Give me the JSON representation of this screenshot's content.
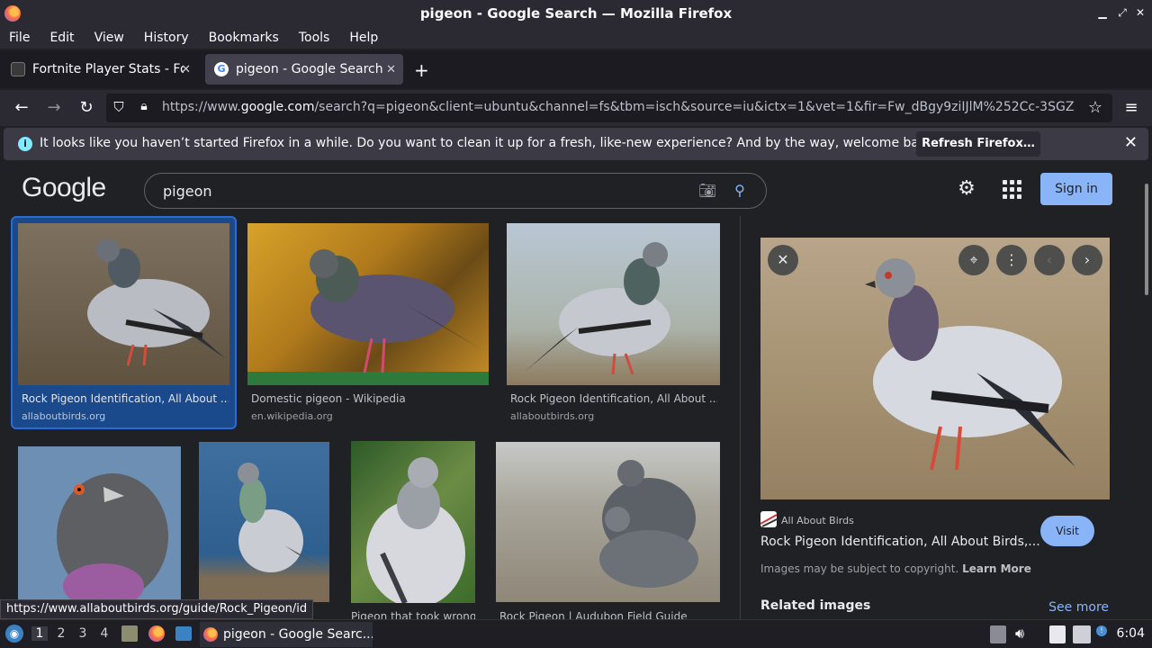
{
  "window": {
    "title": "pigeon - Google Search — Mozilla Firefox"
  },
  "menu": [
    "File",
    "Edit",
    "View",
    "History",
    "Bookmarks",
    "Tools",
    "Help"
  ],
  "tabs": [
    {
      "label": "Fortnite Player Stats - Fo",
      "active": false
    },
    {
      "label": "pigeon - Google Search",
      "active": true
    }
  ],
  "nav": {
    "url_prefix": "https://www.",
    "url_domain": "google.com",
    "url_rest": "/search?q=pigeon&client=ubuntu&channel=fs&tbm=isch&source=iu&ictx=1&vet=1&fir=Fw_dBgy9ziIJlM%252Cc-3SGZ"
  },
  "notification": {
    "message": "It looks like you haven’t started Firefox in a while. Do you want to clean it up for a fresh, like-new experience? And by the way, welcome back!",
    "button": "Refresh Firefox…"
  },
  "google": {
    "logo": "Google",
    "query": "pigeon",
    "signin": "Sign in"
  },
  "results": [
    {
      "title": "Rock Pigeon Identification, All About ...",
      "source": "allaboutbirds.org"
    },
    {
      "title": "Domestic pigeon - Wikipedia",
      "source": "en.wikipedia.org"
    },
    {
      "title": "Rock Pigeon Identification, All About ...",
      "source": "allaboutbirds.org"
    },
    {
      "title": "Pigeon that took wrong ...",
      "source": ""
    },
    {
      "title": "Rock Pigeon | Audubon Field Guide",
      "source": ""
    }
  ],
  "panel": {
    "site": "All About Birds",
    "title": "Rock Pigeon Identification, All About Birds,...",
    "visit": "Visit",
    "copyright": "Images may be subject to copyright.",
    "learn_more": "Learn More",
    "related": "Related images",
    "see_more": "See more"
  },
  "status_link": "https://www.allaboutbirds.org/guide/Rock_Pigeon/id",
  "taskbar": {
    "workspaces": [
      "1",
      "2",
      "3",
      "4"
    ],
    "task": "pigeon - Google Searc...",
    "clock": "6:04"
  }
}
